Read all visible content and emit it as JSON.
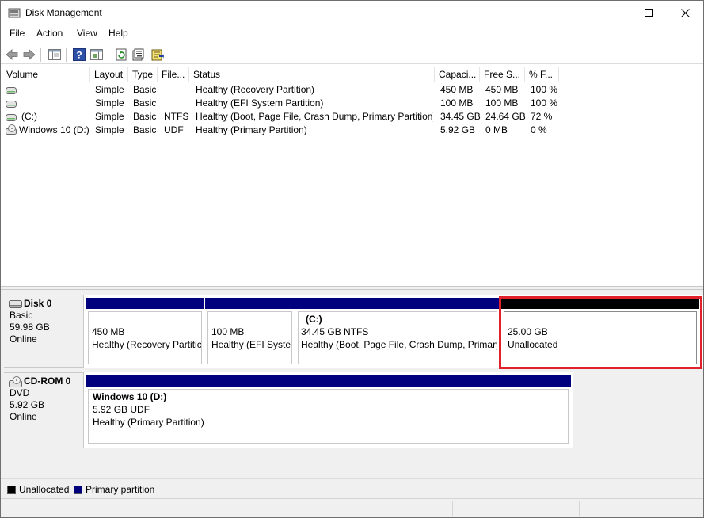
{
  "window": {
    "title": "Disk Management",
    "icon": "disk-management-icon"
  },
  "menu": {
    "file": "File",
    "action": "Action",
    "view": "View",
    "help": "Help"
  },
  "toolbar": {
    "icons": [
      "back-arrow-icon",
      "forward-arrow-icon",
      "console-tree-icon",
      "help-icon",
      "properties-pane-icon",
      "refresh-icon",
      "properties-icon",
      "export-list-icon"
    ]
  },
  "list": {
    "columns": [
      "Volume",
      "Layout",
      "Type",
      "File...",
      "Status",
      "Capaci...",
      "Free S...",
      "% F..."
    ],
    "rows": [
      {
        "volume": "",
        "layout": "Simple",
        "type": "Basic",
        "fs": "",
        "status": "Healthy (Recovery Partition)",
        "capacity": "450 MB",
        "free": "450 MB",
        "pct": "100 %"
      },
      {
        "volume": "",
        "layout": "Simple",
        "type": "Basic",
        "fs": "",
        "status": "Healthy (EFI System Partition)",
        "capacity": "100 MB",
        "free": "100 MB",
        "pct": "100 %"
      },
      {
        "volume": "(C:)",
        "layout": "Simple",
        "type": "Basic",
        "fs": "NTFS",
        "status": "Healthy (Boot, Page File, Crash Dump, Primary Partition)",
        "capacity": "34.45 GB",
        "free": "24.64 GB",
        "pct": "72 %"
      },
      {
        "volume": "Windows 10 (D:)",
        "layout": "Simple",
        "type": "Basic",
        "fs": "UDF",
        "status": "Healthy (Primary Partition)",
        "capacity": "5.92 GB",
        "free": "0 MB",
        "pct": "0 %"
      }
    ]
  },
  "disks": [
    {
      "name": "Disk 0",
      "kind": "Basic",
      "size": "59.98 GB",
      "state": "Online",
      "partitions": [
        {
          "title": "",
          "line1": "450 MB",
          "line2": "Healthy (Recovery Partitic"
        },
        {
          "title": "",
          "line1": "100 MB",
          "line2": "Healthy (EFI Syster"
        },
        {
          "title": "(C:)",
          "line1": "34.45 GB NTFS",
          "line2": "Healthy (Boot, Page File, Crash Dump, Primary"
        },
        {
          "title": "",
          "line1": "25.00 GB",
          "line2": "Unallocated"
        }
      ]
    },
    {
      "name": "CD-ROM 0",
      "kind": "DVD",
      "size": "5.92 GB",
      "state": "Online",
      "partitions": [
        {
          "title": "Windows 10  (D:)",
          "line1": "5.92 GB UDF",
          "line2": "Healthy (Primary Partition)"
        }
      ]
    }
  ],
  "legend": {
    "unallocated": "Unallocated",
    "primary": "Primary partition"
  },
  "colors": {
    "primary": "#00007f",
    "unallocated": "#000000",
    "selection": "#e0202a"
  }
}
